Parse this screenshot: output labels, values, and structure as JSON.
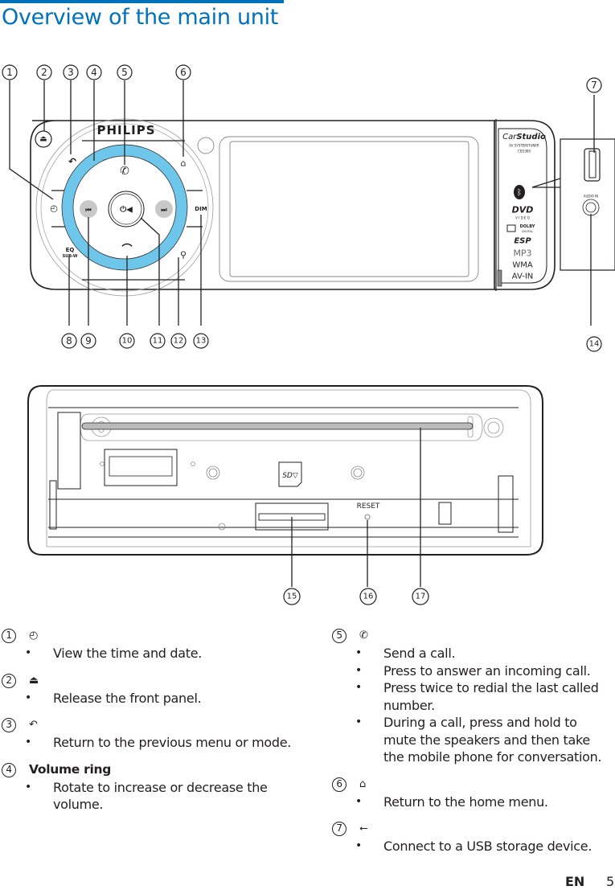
{
  "page": {
    "title": "Overview of the main unit",
    "accent_color": "#0072bc",
    "ring_color": "#6ec6ea",
    "footer": {
      "language": "EN",
      "page_number": "5"
    }
  },
  "front_panel": {
    "brand": "PHILIPS",
    "side_label": {
      "product_line": "CarStudio",
      "product_line_prefix": "Car",
      "product_line_suffix": "Studio",
      "subtitle": "AV SYSTEM/TUNER",
      "model": "CED380"
    },
    "logos": [
      "bluetooth",
      "DVD VIDEO",
      "DOLBY DIGITAL",
      "ESP",
      "MP3",
      "WMA",
      "AV-IN"
    ],
    "dvd_sub": "V I D E O",
    "dolby_line1": "DOLBY",
    "dolby_line2": "DIGITAL",
    "esp": "ESP",
    "mp3": "MP3",
    "wma": "WMA",
    "avin": "AV-IN",
    "buttons": {
      "dim": "DIM",
      "eq": "EQ",
      "subw": "SUB-W"
    },
    "audio_in_label": "AUDIO IN",
    "callouts_top": [
      "1",
      "2",
      "3",
      "4",
      "5",
      "6",
      "7"
    ],
    "callouts_bottom": [
      "8",
      "9",
      "10",
      "11",
      "12",
      "13",
      "14"
    ]
  },
  "rear_panel": {
    "reset_label": "RESET",
    "callouts": [
      "15",
      "16",
      "17"
    ]
  },
  "descriptions": {
    "left": [
      {
        "num": "1",
        "icon": "clock-icon",
        "glyph": "◴",
        "heading": "",
        "bullets": [
          "View the time and date."
        ]
      },
      {
        "num": "2",
        "icon": "eject-icon",
        "glyph": "⏏",
        "heading": "",
        "bullets": [
          "Release the front panel."
        ]
      },
      {
        "num": "3",
        "icon": "back-icon",
        "glyph": "↶",
        "heading": "",
        "bullets": [
          "Return to the previous menu or mode."
        ]
      },
      {
        "num": "4",
        "icon": "",
        "glyph": "",
        "heading": "Volume ring",
        "bullets": [
          "Rotate to increase or decrease the volume."
        ]
      }
    ],
    "right": [
      {
        "num": "5",
        "icon": "call-send-icon",
        "glyph": "✆",
        "heading": "",
        "bullets": [
          "Send a call.",
          "Press to answer an incoming call.",
          "Press twice to redial the last called number.",
          "During a call, press and hold to mute the speakers and then take the mobile phone for conversation."
        ]
      },
      {
        "num": "6",
        "icon": "home-icon",
        "glyph": "⌂",
        "heading": "",
        "bullets": [
          "Return to the home menu."
        ]
      },
      {
        "num": "7",
        "icon": "usb-icon",
        "glyph": "⭠",
        "heading": "",
        "bullets": [
          "Connect to a USB storage device."
        ]
      }
    ]
  }
}
